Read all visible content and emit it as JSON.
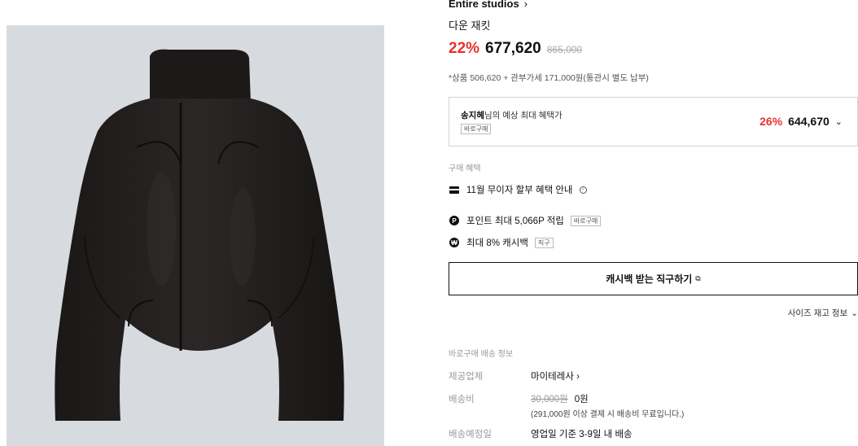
{
  "product": {
    "brand": "Entire studios",
    "name": "다운 재킷",
    "discount": "22%",
    "price": "677,620",
    "original_price": "865,000",
    "tax_note": "*상품 506,620 + 관부가세 171,000원(통관시 별도 납부)"
  },
  "max_benefit": {
    "user_name": "송지혜",
    "title_suffix": "님의 예상 최대 혜택가",
    "tag": "바로구매",
    "discount": "26%",
    "price": "644,670"
  },
  "purchase_benefits": {
    "label": "구매 혜택",
    "installment": "11월 무이자 할부 혜택 안내",
    "points": "포인트 최대 5,066P 적립",
    "points_tag": "바로구매",
    "cashback": "최대 8% 캐시백",
    "cashback_tag": "직구"
  },
  "direct_button": {
    "label": "캐시백 받는 직구하기"
  },
  "size_stock": "사이즈 재고 정보",
  "shipping": {
    "label": "바로구매 배송 정보",
    "vendor_key": "제공업체",
    "vendor_value": "마이테레사",
    "fee_key": "배송비",
    "fee_original": "30,000원",
    "fee_value": "0원",
    "fee_note": "(291,000원 이상 결제 시 배송비 무료입니다.)",
    "eta_key": "배송예정일",
    "eta_value": "영업일 기준 3-9일 내 배송"
  },
  "icons": {
    "brand_chevron": "chevron-right-icon",
    "card": "credit-card-icon",
    "point": "point-icon",
    "cashback": "cashback-icon",
    "external": "external-link-icon"
  },
  "colors": {
    "discount": "#e8312f",
    "image_bg": "#d7dadf"
  }
}
